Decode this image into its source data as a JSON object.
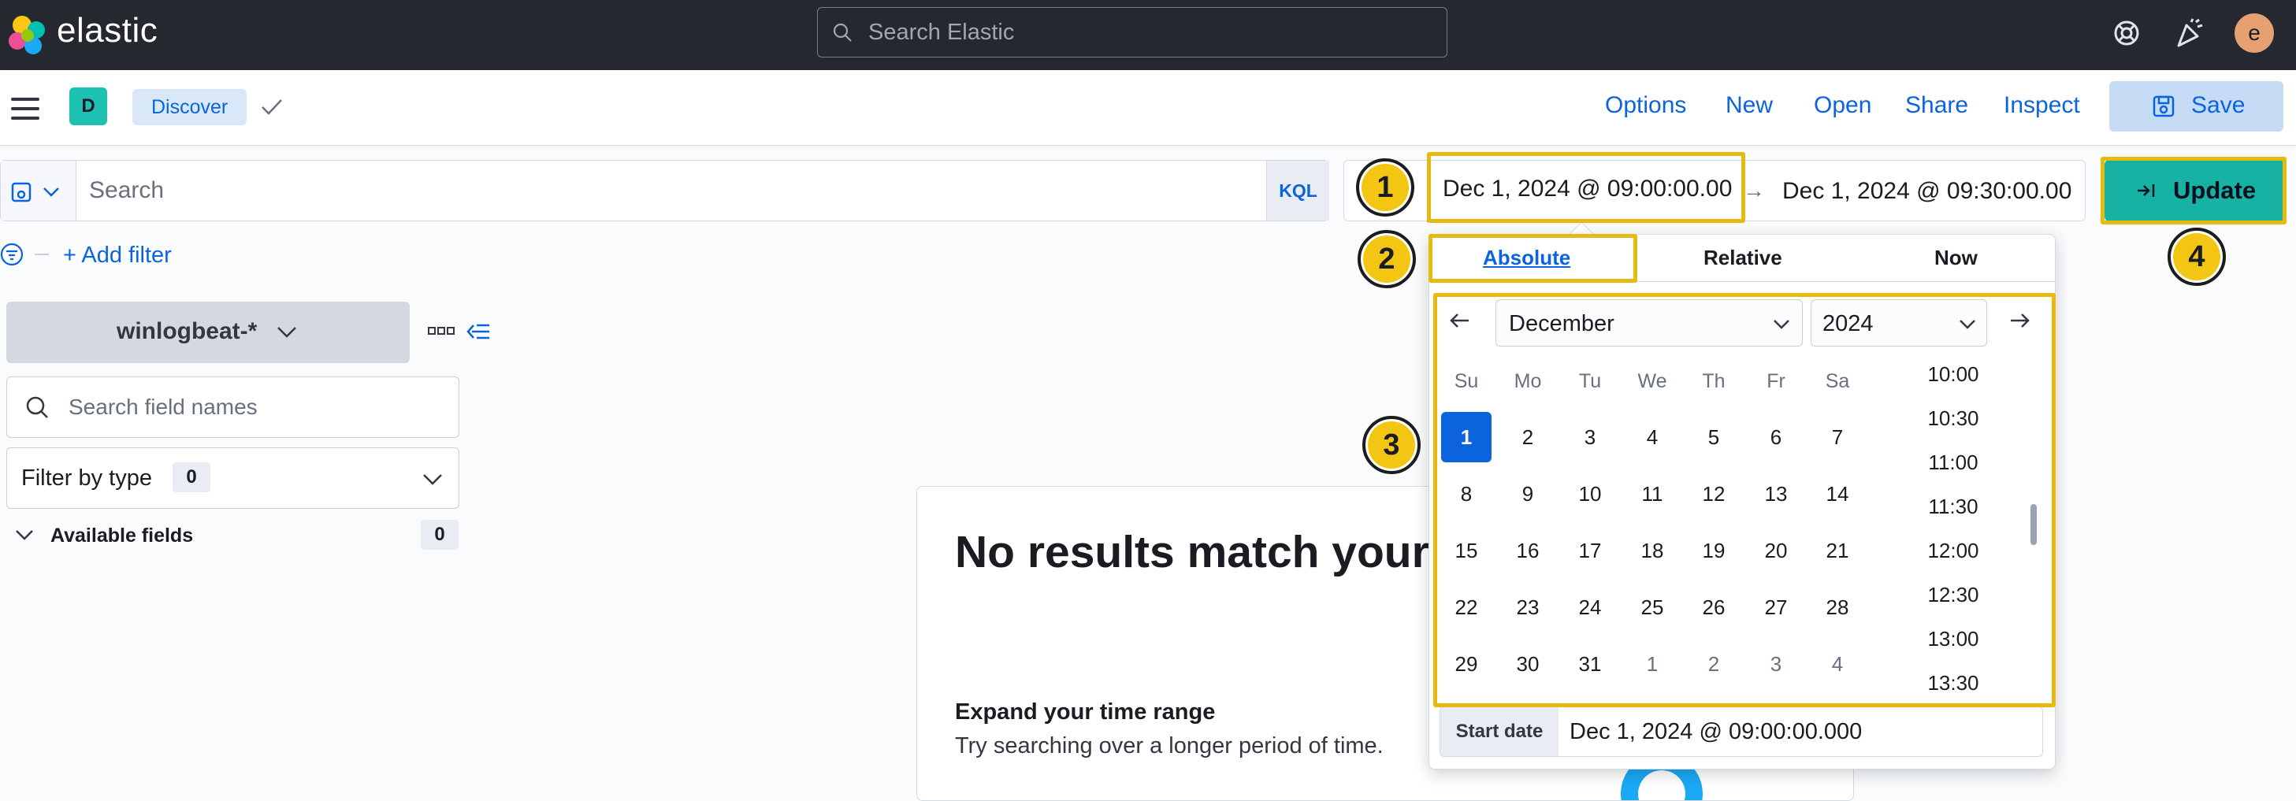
{
  "topbar": {
    "brand": "elastic",
    "search_placeholder": "Search Elastic",
    "avatar_initial": "e"
  },
  "appbar": {
    "space_initial": "D",
    "breadcrumb": "Discover",
    "menu": [
      "Options",
      "New",
      "Open",
      "Share",
      "Inspect"
    ],
    "save_label": "Save"
  },
  "query": {
    "placeholder": "Search",
    "language": "KQL"
  },
  "date_range": {
    "start": "Dec 1, 2024 @ 09:00:00.00",
    "separator": "→",
    "end": "Dec 1, 2024 @ 09:30:00.00",
    "update_label": "Update"
  },
  "filters": {
    "add_label": "+ Add filter"
  },
  "sidebar": {
    "data_view": "winlogbeat-*",
    "field_search_placeholder": "Search field names",
    "filter_by_type_label": "Filter by type",
    "filter_by_type_count": "0",
    "available_fields_label": "Available fields",
    "available_fields_count": "0"
  },
  "main": {
    "title": "No results match your s",
    "suggestion_heading": "Expand your time range",
    "suggestion_text": "Try searching over a longer period of time."
  },
  "popover": {
    "tabs": [
      "Absolute",
      "Relative",
      "Now"
    ],
    "active_tab": "Absolute",
    "month": "December",
    "year": "2024",
    "weekdays": [
      "Su",
      "Mo",
      "Tu",
      "We",
      "Th",
      "Fr",
      "Sa"
    ],
    "weeks": [
      [
        "1",
        "2",
        "3",
        "4",
        "5",
        "6",
        "7"
      ],
      [
        "8",
        "9",
        "10",
        "11",
        "12",
        "13",
        "14"
      ],
      [
        "15",
        "16",
        "17",
        "18",
        "19",
        "20",
        "21"
      ],
      [
        "22",
        "23",
        "24",
        "25",
        "26",
        "27",
        "28"
      ],
      [
        "29",
        "30",
        "31",
        "1",
        "2",
        "3",
        "4"
      ]
    ],
    "selected_day": "1",
    "times": [
      "10:00",
      "10:30",
      "11:00",
      "11:30",
      "12:00",
      "12:30",
      "13:00",
      "13:30"
    ],
    "start_date_label": "Start date",
    "start_date_value": "Dec 1, 2024 @ 09:00:00.000"
  },
  "annotations": [
    "1",
    "2",
    "3",
    "4"
  ],
  "colors": {
    "topbar_bg": "#25282f",
    "link_blue": "#0b64dd",
    "update_teal": "#16b3a4",
    "highlight_yellow": "#e8b90f",
    "marker_fill": "#f2c613"
  }
}
